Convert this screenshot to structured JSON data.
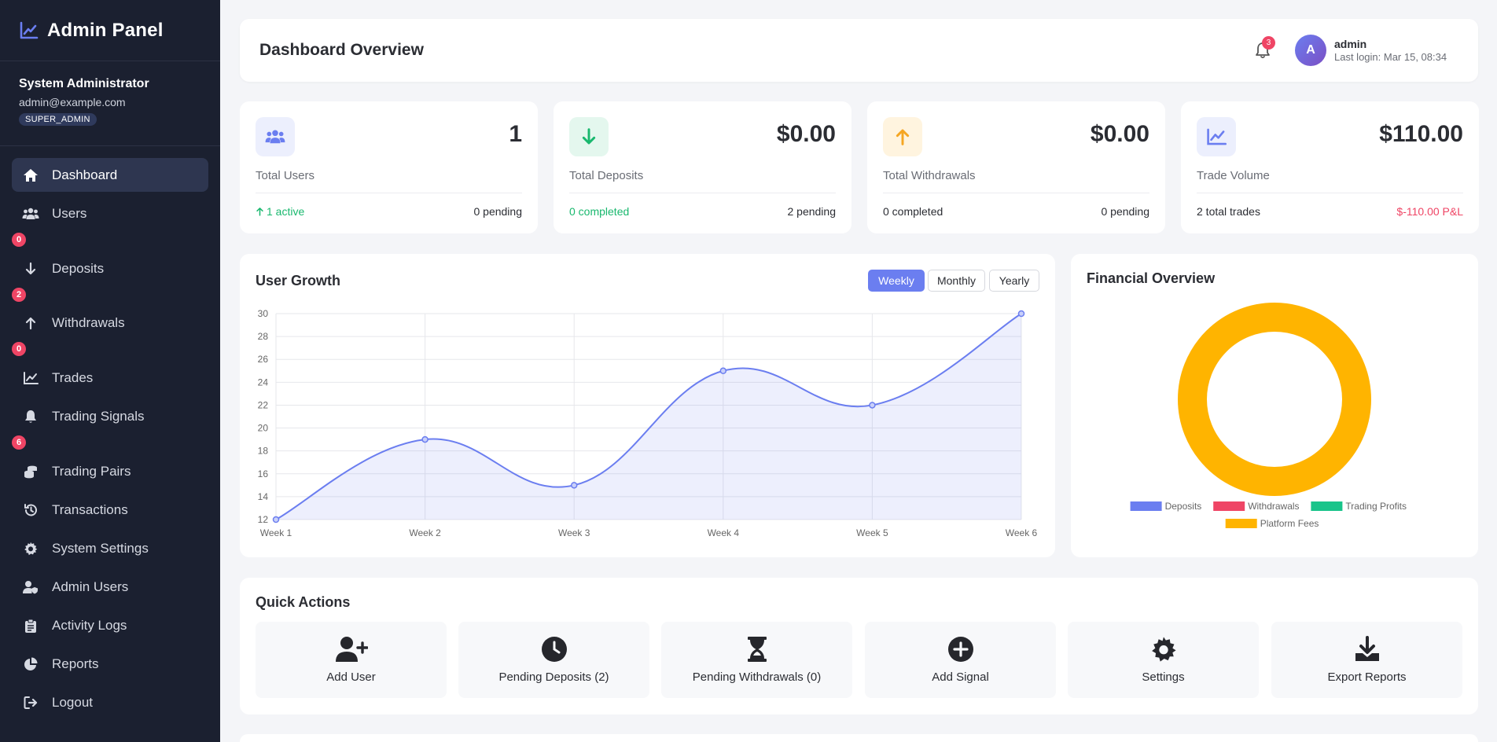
{
  "sidebar": {
    "brand": "Admin Panel",
    "user": {
      "name": "System Administrator",
      "email": "admin@example.com",
      "role": "SUPER_ADMIN"
    },
    "items": [
      {
        "label": "Dashboard",
        "icon": "home-icon"
      },
      {
        "label": "Users",
        "icon": "users-icon",
        "badge": "0"
      },
      {
        "label": "Deposits",
        "icon": "arrow-down-icon",
        "badge": "2"
      },
      {
        "label": "Withdrawals",
        "icon": "arrow-up-icon",
        "badge": "0"
      },
      {
        "label": "Trades",
        "icon": "chart-line-icon"
      },
      {
        "label": "Trading Signals",
        "icon": "bell-icon",
        "badge": "6"
      },
      {
        "label": "Trading Pairs",
        "icon": "coins-icon"
      },
      {
        "label": "Transactions",
        "icon": "history-icon"
      },
      {
        "label": "System Settings",
        "icon": "gear-icon"
      },
      {
        "label": "Admin Users",
        "icon": "user-shield-icon"
      },
      {
        "label": "Activity Logs",
        "icon": "clipboard-icon"
      },
      {
        "label": "Reports",
        "icon": "pie-chart-icon"
      },
      {
        "label": "Logout",
        "icon": "logout-icon"
      }
    ]
  },
  "header": {
    "title": "Dashboard Overview",
    "notifications": "3",
    "avatar_initial": "A",
    "username": "admin",
    "last_login": "Last login: Mar 15, 08:34"
  },
  "stats": [
    {
      "label": "Total Users",
      "value": "1",
      "left": "1 active",
      "right": "0 pending",
      "icon": "users-icon",
      "accent": "#6b7ef0"
    },
    {
      "label": "Total Deposits",
      "value": "$0.00",
      "left": "0 completed",
      "right": "2 pending",
      "icon": "arrow-down-icon",
      "accent": "#19b86e"
    },
    {
      "label": "Total Withdrawals",
      "value": "$0.00",
      "left": "0 completed",
      "right": "0 pending",
      "icon": "arrow-up-icon",
      "accent": "#f5a623"
    },
    {
      "label": "Trade Volume",
      "value": "$110.00",
      "left": "2 total trades",
      "right": "$-110.00 P&L",
      "icon": "chart-line-icon",
      "accent": "#6b7ef0"
    }
  ],
  "growth": {
    "title": "User Growth",
    "tabs": [
      "Weekly",
      "Monthly",
      "Yearly"
    ],
    "active_tab": "Weekly"
  },
  "financial": {
    "title": "Financial Overview"
  },
  "quick_actions": {
    "title": "Quick Actions",
    "items": [
      {
        "label": "Add User",
        "icon": "user-plus-icon"
      },
      {
        "label": "Pending Deposits (2)",
        "icon": "clock-icon"
      },
      {
        "label": "Pending Withdrawals (0)",
        "icon": "hourglass-icon"
      },
      {
        "label": "Add Signal",
        "icon": "plus-circle-icon"
      },
      {
        "label": "Settings",
        "icon": "gear-icon"
      },
      {
        "label": "Export Reports",
        "icon": "download-icon"
      }
    ]
  },
  "chart_data": [
    {
      "type": "line",
      "x": [
        "Week 1",
        "Week 2",
        "Week 3",
        "Week 4",
        "Week 5",
        "Week 6"
      ],
      "series": [
        {
          "values": [
            12,
            19,
            15,
            25,
            22,
            30
          ],
          "color": "#6b7ef0"
        }
      ],
      "ylim": [
        12,
        30
      ],
      "yticks": [
        12,
        14,
        16,
        18,
        20,
        22,
        24,
        26,
        28,
        30
      ],
      "grid": true
    },
    {
      "type": "pie",
      "donut": true,
      "labels": [
        "Deposits",
        "Withdrawals",
        "Trading Profits",
        "Platform Fees"
      ],
      "values": [
        0,
        0,
        0,
        1
      ],
      "colors": [
        "#6b7ef0",
        "#ef4565",
        "#19c48a",
        "#ffb400"
      ],
      "legend_position": "bottom"
    }
  ]
}
